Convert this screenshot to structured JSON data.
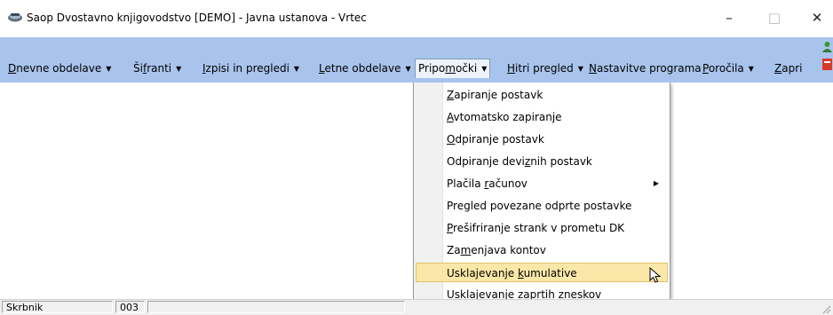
{
  "window": {
    "title": "Saop Dvostavno knjigovodstvo [DEMO] - Javna ustanova - Vrtec",
    "minimize": "–",
    "maximize": "□",
    "close": "✕"
  },
  "menubar": {
    "items": [
      {
        "pre": "",
        "u": "D",
        "post": "nevne obdelave",
        "arrow": true
      },
      {
        "pre": "Ši",
        "u": "f",
        "post": "ranti",
        "arrow": true
      },
      {
        "pre": "",
        "u": "I",
        "post": "zpisi in pregledi",
        "arrow": true
      },
      {
        "pre": "",
        "u": "L",
        "post": "etne obdelave",
        "arrow": true
      },
      {
        "pre": "Pripo",
        "u": "m",
        "post": "očki",
        "arrow": true
      },
      {
        "pre": "",
        "u": "H",
        "post": "itri pregled",
        "arrow": true
      },
      {
        "pre": "",
        "u": "N",
        "post": "astavitve programa",
        "arrow": false
      },
      {
        "pre": "",
        "u": "P",
        "post": "oročila",
        "arrow": true
      },
      {
        "pre": "",
        "u": "Z",
        "post": "apri",
        "arrow": false
      }
    ],
    "bg_color": "#a9c4ec"
  },
  "dropdown": {
    "items": [
      {
        "pre": "",
        "u": "Z",
        "post": "apiranje postavk"
      },
      {
        "pre": "",
        "u": "A",
        "post": "vtomatsko zapiranje"
      },
      {
        "pre": "",
        "u": "O",
        "post": "dpiranje postavk"
      },
      {
        "pre": "Odpiranje devi",
        "u": "z",
        "post": "nih postavk"
      },
      {
        "pre": "Plačila ",
        "u": "r",
        "post": "ačunov"
      },
      {
        "pre": "Pregled povezane odprte postavke",
        "u": "",
        "post": ""
      },
      {
        "pre": "",
        "u": "P",
        "post": "rešifriranje strank v prometu DK"
      },
      {
        "pre": "Za",
        "u": "m",
        "post": "enjava kontov"
      },
      {
        "pre": "Usklajevanje ",
        "u": "k",
        "post": "umulative"
      },
      {
        "pre": "Usklaje",
        "u": "v",
        "post": "anje zaprtih zneskov"
      }
    ],
    "highlight_color": "#fbe7a7"
  },
  "statusbar": {
    "user": "Skrbnik",
    "code": "003"
  },
  "icons": {
    "app": "app-logo-icon",
    "side_top": "green-person-icon",
    "side_bottom": "red-document-icon",
    "submenu": "submenu-arrow-icon",
    "cursor": "mouse-pointer-icon",
    "grip": "resize-grip-icon"
  }
}
